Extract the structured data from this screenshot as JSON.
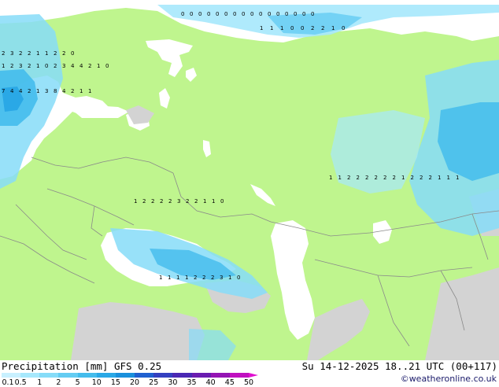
{
  "title_left": "Precipitation [mm] GFS 0.25",
  "title_right": "Su 14-12-2025 18..21 UTC (00+117)",
  "credit": "©weatheronline.co.uk",
  "colors": {
    "land": "#bff58e",
    "water": "#ffffff",
    "mountain": "#d3d3d3",
    "border": "#8a8a8a",
    "marker": "#000000"
  },
  "legend": {
    "ticks": [
      "0.1",
      "0.5",
      "1",
      "2",
      "5",
      "10",
      "15",
      "20",
      "25",
      "30",
      "35",
      "40",
      "45",
      "50"
    ],
    "colors": [
      "#c8f0ff",
      "#a6e8fc",
      "#86dcf8",
      "#64ccf2",
      "#44bcec",
      "#2aa8e6",
      "#1a90dc",
      "#2060d0",
      "#3440c0",
      "#4a28b4",
      "#6a1cb0",
      "#9414b4",
      "#c010c0",
      "#e010d0"
    ]
  },
  "precip_labels": [
    [
      "0",
      "0",
      "0",
      "0",
      "0",
      "0",
      "0",
      "0",
      "0",
      "0",
      "0",
      "0",
      "0",
      "0",
      "0",
      "0"
    ],
    [
      "1",
      "1",
      "1",
      "0",
      "0",
      "2",
      "2",
      "1",
      "0"
    ],
    [
      "2",
      "3",
      "2",
      "2",
      "1",
      "1",
      "2",
      "2",
      "0"
    ],
    [
      "1",
      "2",
      "3",
      "2",
      "1",
      "0",
      "2",
      "3",
      "4",
      "4",
      "2",
      "1",
      "0"
    ],
    [
      "7",
      "4",
      "4",
      "2",
      "1",
      "3",
      "8",
      "4",
      "2",
      "1",
      "1"
    ],
    [
      "1",
      "1",
      "2",
      "2",
      "2",
      "2",
      "2",
      "2",
      "1",
      "2",
      "2",
      "2",
      "1",
      "1",
      "1"
    ],
    [
      "1",
      "2",
      "2",
      "2",
      "2",
      "3",
      "2",
      "2",
      "1",
      "1",
      "0"
    ],
    [
      "1",
      "1",
      "1",
      "1",
      "2",
      "2",
      "2",
      "3",
      "1",
      "0"
    ]
  ]
}
